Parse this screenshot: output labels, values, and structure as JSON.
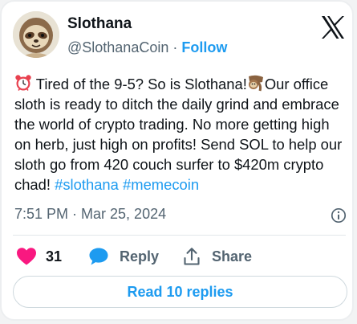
{
  "author": {
    "display_name": "Slothana",
    "handle": "@SlothanaCoin",
    "separator": "·",
    "follow_label": "Follow"
  },
  "tweet": {
    "line1_before_emoji": "Tired of the 9-5? So is Slothana!",
    "line1_after_emoji": "Our",
    "body": "office sloth is ready to ditch the daily grind and embrace the world of crypto trading. No more getting high on herb, just high on profits! Send SOL to help our sloth go from 420 couch surfer to $420m crypto chad!",
    "hashtags": [
      "#slothana",
      "#memecoin"
    ],
    "timestamp": "7:51 PM · Mar 25, 2024"
  },
  "actions": {
    "like_count": "31",
    "reply_label": "Reply",
    "share_label": "Share"
  },
  "read_replies_label": "Read 10 replies",
  "colors": {
    "accent": "#1d9bf0",
    "like": "#f91880",
    "text": "#0f1419",
    "muted": "#536471"
  },
  "icons": [
    "alarm-clock-emoji",
    "sloth-emoji",
    "x-logo-icon",
    "info-icon",
    "heart-icon",
    "reply-bubble-icon",
    "share-icon"
  ]
}
